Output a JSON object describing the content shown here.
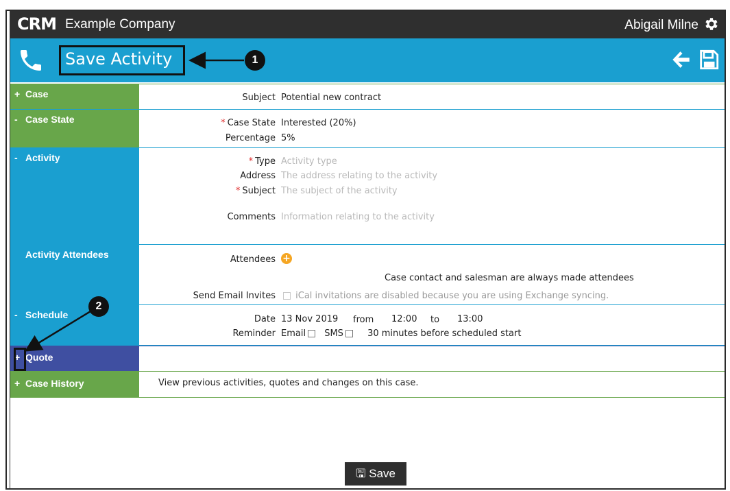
{
  "header": {
    "logo_text": "CRM",
    "company": "Example Company",
    "user": "Abigail Milne",
    "icons": [
      "gear-icon"
    ]
  },
  "titlebar": {
    "title": "Save Activity",
    "icons": [
      "phone-icon",
      "back-arrow-icon",
      "save-icon"
    ]
  },
  "sections": {
    "case": {
      "sign": "+",
      "label": "Case",
      "subject_label": "Subject",
      "subject_value": "Potential new contract"
    },
    "case_state": {
      "sign": "-",
      "label": "Case State",
      "state_label": "Case State",
      "state_value": "Interested (20%)",
      "percentage_label": "Percentage",
      "percentage_value": "5%"
    },
    "activity": {
      "sign": "-",
      "label": "Activity",
      "type_label": "Type",
      "type_placeholder": "Activity type",
      "address_label": "Address",
      "address_placeholder": "The address relating to the activity",
      "subject_label": "Subject",
      "subject_placeholder": "The subject of the activity",
      "comments_label": "Comments",
      "comments_placeholder": "Information relating to the activity"
    },
    "attendees": {
      "label": "Activity Attendees",
      "attendees_label": "Attendees",
      "note": "Case contact and salesman are always made attendees",
      "invites_label": "Send Email Invites",
      "invites_note": "iCal invitations are disabled because you are using Exchange syncing."
    },
    "schedule": {
      "sign": "-",
      "label": "Schedule",
      "date_label": "Date",
      "date_value": "13 Nov 2019",
      "from": "from",
      "start": "12:00",
      "to": "to",
      "end": "13:00",
      "reminder_label": "Reminder",
      "email": "Email",
      "sms": "SMS",
      "minutes": "30 minutes",
      "before": "before scheduled start"
    },
    "quote": {
      "sign": "+",
      "label": "Quote"
    },
    "history": {
      "sign": "+",
      "label": "Case History",
      "note": "View previous activities, quotes and changes on this case."
    }
  },
  "callouts": {
    "one": "1",
    "two": "2"
  },
  "required_mark": "*",
  "footer": {
    "save_label": "Save"
  },
  "colors": {
    "green": "#68a64a",
    "blue": "#1a9fd0",
    "purple": "#3f4fa1",
    "dark": "#2f2f2f",
    "orange": "#f5a623"
  }
}
